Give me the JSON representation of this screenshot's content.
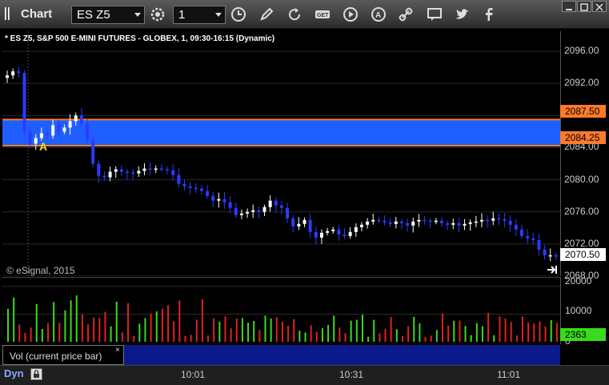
{
  "toolbar": {
    "title": "Chart",
    "symbol": "ES Z5",
    "interval": "1",
    "icons": [
      "settings-gear-icon",
      "clock-icon",
      "pencil-icon",
      "refresh-icon",
      "get-icon",
      "play-icon",
      "alert-icon",
      "link-icon",
      "chat-icon",
      "twitter-icon",
      "facebook-icon"
    ]
  },
  "chart": {
    "title": "* ES Z5, S&P 500 E-MINI FUTURES - GLOBEX, 1, 09:30-16:15 (Dynamic)",
    "copyright": "© eSignal, 2015",
    "marker": "A",
    "last_price": "2070.50",
    "upper_line": "2087.50",
    "lower_line": "2084.25",
    "band_color": "#1f5fff",
    "line_color": "#ff7a2a"
  },
  "chart_data": {
    "type": "candlestick",
    "y_ticks": [
      "2096.00",
      "2092.00",
      "2088.00",
      "2084.00",
      "2080.00",
      "2076.00",
      "2072.00",
      "2068.00"
    ],
    "ylim": [
      2068,
      2098.5
    ],
    "x_ticks": [
      "10:01",
      "10:31",
      "11:01"
    ],
    "close_series": [
      2093,
      2093.5,
      2093.3,
      2086.0,
      2084.5,
      2085.2,
      2085.8,
      2085.5,
      2086.8,
      2086.0,
      2086.5,
      2087.3,
      2088.0,
      2087.0,
      2085.0,
      2082.0,
      2080.5,
      2080.3,
      2081.0,
      2081.3,
      2081.0,
      2080.9,
      2080.8,
      2081.1,
      2081.4,
      2081.3,
      2081.4,
      2081.3,
      2081.2,
      2080.6,
      2079.5,
      2079.2,
      2079.0,
      2078.9,
      2078.6,
      2078.0,
      2077.4,
      2077.6,
      2077.2,
      2076.5,
      2075.6,
      2075.8,
      2076.0,
      2076.2,
      2076.0,
      2076.6,
      2077.4,
      2076.8,
      2076.5,
      2075.2,
      2074.2,
      2074.5,
      2075.0,
      2073.5,
      2072.8,
      2073.4,
      2073.6,
      2073.8,
      2073.2,
      2073.0,
      2073.5,
      2074.1,
      2074.4,
      2074.8,
      2075.0,
      2074.9,
      2074.7,
      2074.5,
      2074.8,
      2074.6,
      2074.3,
      2074.8,
      2075.0,
      2074.9,
      2074.8,
      2074.9,
      2074.6,
      2074.4,
      2074.6,
      2074.3,
      2074.5,
      2074.7,
      2074.8,
      2075.0,
      2074.9,
      2075.2,
      2075.1,
      2074.9,
      2074.4,
      2073.8,
      2073.0,
      2072.7,
      2072.5,
      2071.3,
      2070.6,
      2070.6,
      2070.5
    ],
    "volume_ticks": [
      "20000",
      "10000",
      "0"
    ],
    "volume_last": "2363"
  },
  "volume_panel": {
    "label": "Vol (current price bar)",
    "close": "×"
  },
  "bottom": {
    "mode": "Dyn"
  }
}
